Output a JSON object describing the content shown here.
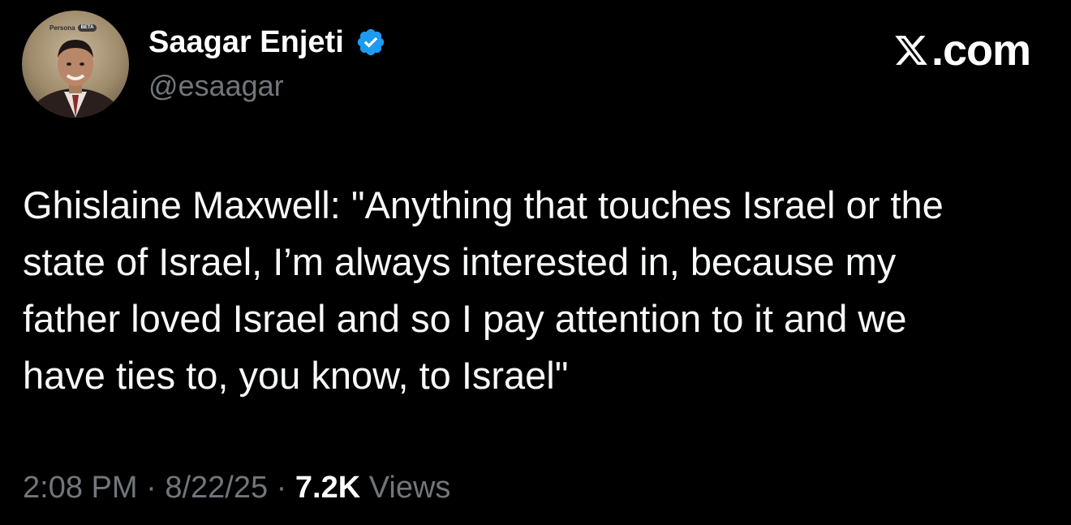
{
  "author": {
    "avatar_badge": "Persona",
    "avatar_badge_tag": "BETA",
    "display_name": "Saagar Enjeti",
    "handle": "@esaagar",
    "verified_icon": "verified-badge-icon",
    "verified_color": "#1d9bf0"
  },
  "brand": {
    "icon": "x-logo-icon",
    "label": ".com"
  },
  "tweet": {
    "text": "Ghislaine Maxwell: \"Anything that touches Israel or the\nstate of Israel, I’m always interested in, because my\nfather loved Israel and so I pay attention to it and we\nhave ties to, you know, to Israel\""
  },
  "meta": {
    "time": "2:08 PM",
    "separator": "·",
    "date": "8/22/25",
    "views_count": "7.2K",
    "views_label": "Views"
  },
  "colors": {
    "background": "#000000",
    "primary_text": "#e7e9ea",
    "secondary_text": "#71767b",
    "accent": "#1d9bf0"
  }
}
